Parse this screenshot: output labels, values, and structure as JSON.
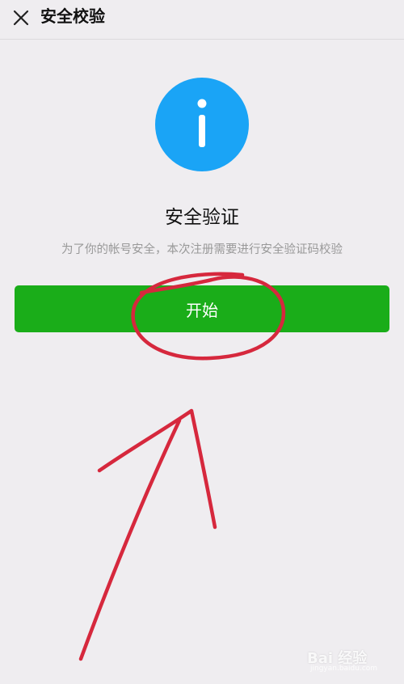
{
  "header": {
    "title": "安全校验",
    "close_icon": "close-icon"
  },
  "main": {
    "icon": "info-icon",
    "icon_color": "#1aa4f6",
    "heading": "安全验证",
    "description": "为了你的帐号安全，本次注册需要进行安全验证码校验",
    "start_button_label": "开始",
    "button_color": "#1aad19"
  },
  "watermark": {
    "brand": "Bai 经验",
    "url": "jingyan.baidu.com"
  }
}
